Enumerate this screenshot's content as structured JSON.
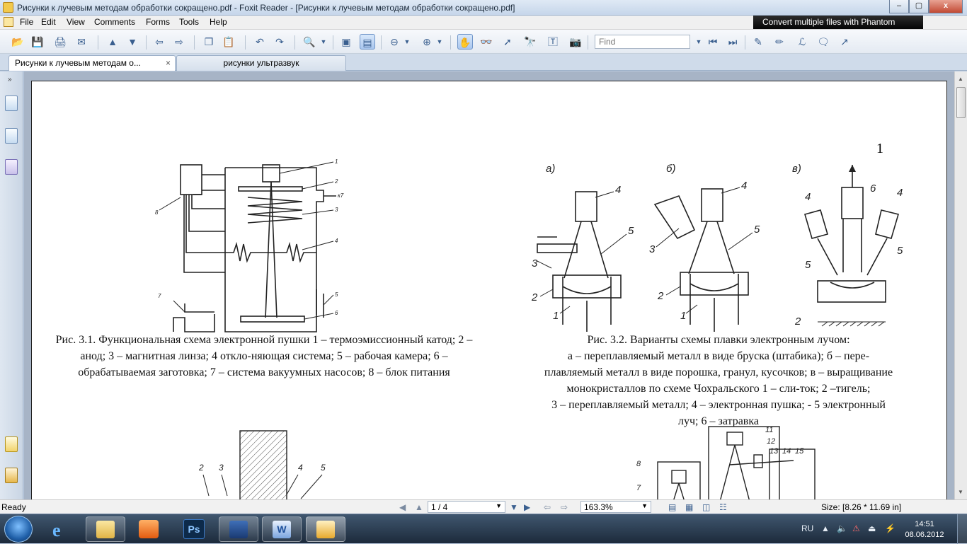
{
  "window": {
    "title": "Рисунки к лучевым методам обработки сокращено.pdf - Foxit Reader - [Рисунки к лучевым методам обработки сокращено.pdf]",
    "minimize_label": "–",
    "maximize_label": "▢",
    "close_label": "x"
  },
  "menu": {
    "items": [
      "File",
      "Edit",
      "View",
      "Comments",
      "Forms",
      "Tools",
      "Help"
    ],
    "promo": "Convert multiple files with Phantom"
  },
  "toolbar": {
    "find_placeholder": "Find"
  },
  "tabs": [
    {
      "label": "Рисунки к лучевым методам о...",
      "close": "×"
    },
    {
      "label": "рисунки ультразвук"
    }
  ],
  "page": {
    "page_number": "1",
    "figure1": {
      "labels": [
        "1",
        "2",
        "3",
        "4",
        "5",
        "6",
        "7",
        "8",
        "к7"
      ],
      "caption": "Рис. 3.1. Функциональная схема электронной пушки 1 – термоэмиссионный катод; 2 – анод; 3 – магнитная линза; 4 откло-няющая система; 5 – рабочая камера; 6 – обрабатываемая заготовка; 7 – система вакуумных насосов; 8 – блок питания"
    },
    "figure2": {
      "panel_labels": [
        "а)",
        "б)",
        "в)"
      ],
      "caption_lines": [
        "Рис. 3.2. Варианты схемы плавки электронным лучом:",
        "а – переплавляемый металл в виде бруска (штабика); б – пере-",
        "плавляемый металл в виде порошка, гранул, кусочков; в – выращивание",
        "монокристаллов по схеме Чохральского 1 – сли-ток; 2 –тигель;",
        "3 – переплавляемый металл; 4 – электронная пушка; - 5 электронный",
        "луч; 6 – затравка"
      ]
    },
    "figure3": {
      "labels": [
        "2",
        "3",
        "4",
        "5"
      ]
    },
    "figure4": {
      "labels": [
        "8",
        "7",
        "11",
        "12",
        "13",
        "14",
        "15"
      ]
    }
  },
  "status": {
    "ready": "Ready",
    "page_field": "1 / 4",
    "zoom_field": "163.3%",
    "size": "Size: [8.26 * 11.69 in]"
  },
  "taskbar": {
    "time": "14:51",
    "date": "08.06.2012",
    "lang": "RU"
  }
}
